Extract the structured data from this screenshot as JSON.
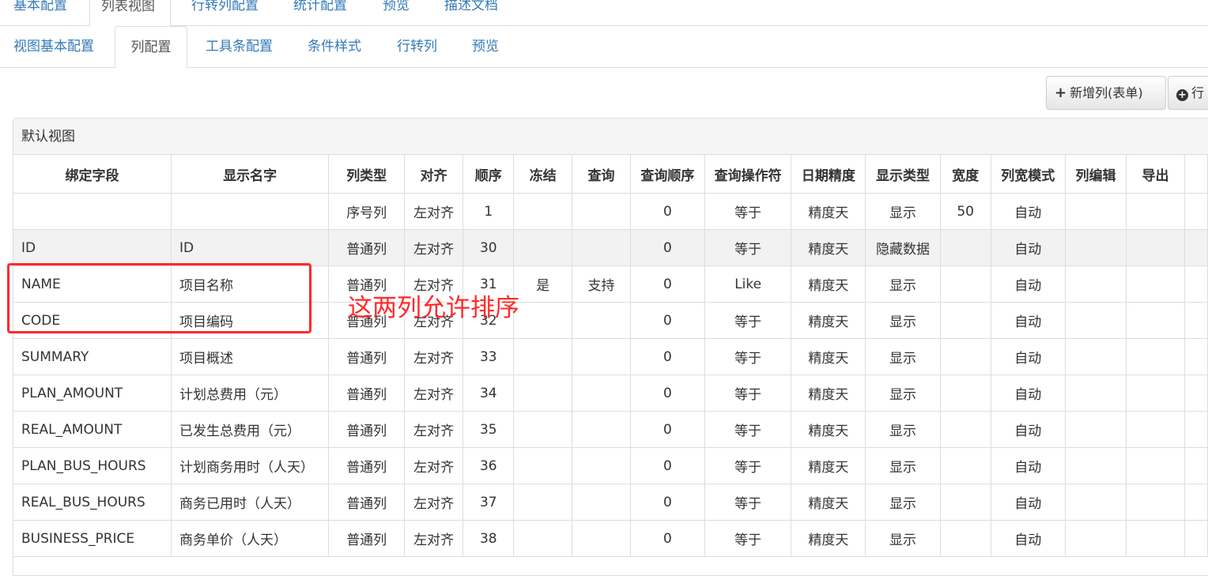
{
  "top_tabs": [
    {
      "label": "基本配置",
      "active": false
    },
    {
      "label": "列表视图",
      "active": true
    },
    {
      "label": "行转列配置",
      "active": false
    },
    {
      "label": "统计配置",
      "active": false
    },
    {
      "label": "预览",
      "active": false
    },
    {
      "label": "描述文档",
      "active": false
    }
  ],
  "sub_tabs": [
    {
      "label": "视图基本配置",
      "active": false
    },
    {
      "label": "列配置",
      "active": true
    },
    {
      "label": "工具条配置",
      "active": false
    },
    {
      "label": "条件样式",
      "active": false
    },
    {
      "label": "行转列",
      "active": false
    },
    {
      "label": "预览",
      "active": false
    }
  ],
  "toolbar": {
    "add_column_label": "新增列(表单)",
    "add_column_icon": "plus-icon",
    "add_row_label": "行",
    "add_row_icon": "plus-circle-icon"
  },
  "panel": {
    "title": "默认视图"
  },
  "table": {
    "headers": [
      "绑定字段",
      "显示名字",
      "列类型",
      "对齐",
      "顺序",
      "冻结",
      "查询",
      "查询顺序",
      "查询操作符",
      "日期精度",
      "显示类型",
      "宽度",
      "列宽模式",
      "列编辑",
      "导出"
    ],
    "rows": [
      [
        "",
        "",
        "序号列",
        "左对齐",
        "1",
        "",
        "",
        "0",
        "等于",
        "精度天",
        "显示",
        "50",
        "自动",
        "",
        ""
      ],
      [
        "ID",
        "ID",
        "普通列",
        "左对齐",
        "30",
        "",
        "",
        "0",
        "等于",
        "精度天",
        "隐藏数据",
        "",
        "自动",
        "",
        ""
      ],
      [
        "NAME",
        "项目名称",
        "普通列",
        "左对齐",
        "31",
        "是",
        "支持",
        "0",
        "Like",
        "精度天",
        "显示",
        "",
        "自动",
        "",
        ""
      ],
      [
        "CODE",
        "项目编码",
        "普通列",
        "左对齐",
        "32",
        "",
        "",
        "0",
        "等于",
        "精度天",
        "显示",
        "",
        "自动",
        "",
        ""
      ],
      [
        "SUMMARY",
        "项目概述",
        "普通列",
        "左对齐",
        "33",
        "",
        "",
        "0",
        "等于",
        "精度天",
        "显示",
        "",
        "自动",
        "",
        ""
      ],
      [
        "PLAN_AMOUNT",
        "计划总费用（元）",
        "普通列",
        "左对齐",
        "34",
        "",
        "",
        "0",
        "等于",
        "精度天",
        "显示",
        "",
        "自动",
        "",
        ""
      ],
      [
        "REAL_AMOUNT",
        "已发生总费用（元）",
        "普通列",
        "左对齐",
        "35",
        "",
        "",
        "0",
        "等于",
        "精度天",
        "显示",
        "",
        "自动",
        "",
        ""
      ],
      [
        "PLAN_BUS_HOURS",
        "计划商务用时（人天）",
        "普通列",
        "左对齐",
        "36",
        "",
        "",
        "0",
        "等于",
        "精度天",
        "显示",
        "",
        "自动",
        "",
        ""
      ],
      [
        "REAL_BUS_HOURS",
        "商务已用时（人天）",
        "普通列",
        "左对齐",
        "37",
        "",
        "",
        "0",
        "等于",
        "精度天",
        "显示",
        "",
        "自动",
        "",
        ""
      ],
      [
        "BUSINESS_PRICE",
        "商务单价（人天）",
        "普通列",
        "左对齐",
        "38",
        "",
        "",
        "0",
        "等于",
        "精度天",
        "显示",
        "",
        "自动",
        "",
        ""
      ]
    ]
  },
  "annotation": {
    "text": "这两列允许排序",
    "color": "#ff2a2a"
  },
  "colors": {
    "link": "#337ab7",
    "border": "#dddddd",
    "header_bg": "#f5f5f5",
    "alt_row": "#f2f2f2"
  }
}
